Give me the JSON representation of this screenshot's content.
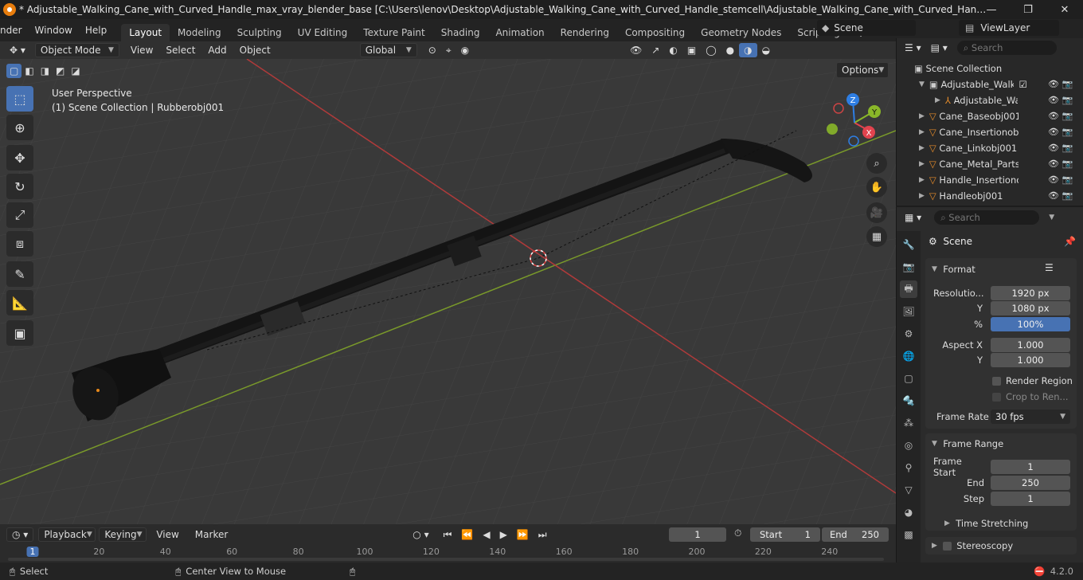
{
  "window": {
    "title": "* Adjustable_Walking_Cane_with_Curved_Handle_max_vray_blender_base [C:\\Users\\lenov\\Desktop\\Adjustable_Walking_Cane_with_Curved_Handle_stemcell\\Adjustable_Walking_Cane_with_Curved_Handle_max_vray_blender_...",
    "min": "—",
    "max": "❐",
    "close": "✕"
  },
  "menu": [
    "nder",
    "Window",
    "Help"
  ],
  "workspaces": [
    "Layout",
    "Modeling",
    "Sculpting",
    "UV Editing",
    "Texture Paint",
    "Shading",
    "Animation",
    "Rendering",
    "Compositing",
    "Geometry Nodes",
    "Scripting"
  ],
  "scene": {
    "scene_label": "Scene",
    "viewlayer_label": "ViewLayer"
  },
  "viewport_header": {
    "mode": "Object Mode",
    "menus": [
      "View",
      "Select",
      "Add",
      "Object"
    ],
    "transform": "Global",
    "options": "Options"
  },
  "viewport": {
    "perspective": "User Perspective",
    "collection_info": "(1) Scene Collection | Rubberobj001",
    "gizmo": {
      "x": "X",
      "y": "Y",
      "z": "Z"
    }
  },
  "outliner": {
    "search_placeholder": "Search",
    "root": "Scene Collection",
    "items": [
      "Adjustable_Walking",
      "Adjustable_Wa",
      "Cane_Baseobj001",
      "Cane_Insertionobj",
      "Cane_Linkobj001",
      "Cane_Metal_Partso",
      "Handle_Insertionol",
      "Handleobj001"
    ]
  },
  "properties": {
    "search_placeholder": "Search",
    "context": "Scene",
    "format": {
      "title": "Format",
      "res_x_label": "Resolutio...",
      "res_x": "1920 px",
      "res_y_label": "Y",
      "res_y": "1080 px",
      "pct_label": "%",
      "pct": "100%",
      "aspect_x_label": "Aspect X",
      "aspect_x": "1.000",
      "aspect_y_label": "Y",
      "aspect_y": "1.000",
      "render_region": "Render Region",
      "crop": "Crop to Ren...",
      "frame_rate_label": "Frame Rate",
      "frame_rate": "30 fps"
    },
    "frame_range": {
      "title": "Frame Range",
      "start_label": "Frame Start",
      "start": "1",
      "end_label": "End",
      "end": "250",
      "step_label": "Step",
      "step": "1"
    },
    "time_stretching": "Time Stretching",
    "stereoscopy": "Stereoscopy"
  },
  "timeline": {
    "menus": [
      "Playback",
      "Keying",
      "View",
      "Marker"
    ],
    "current_frame": "1",
    "start_label": "Start",
    "start": "1",
    "end_label": "End",
    "end": "250",
    "ticks": [
      "1",
      "20",
      "40",
      "60",
      "80",
      "100",
      "120",
      "140",
      "160",
      "180",
      "200",
      "220",
      "240"
    ]
  },
  "status": {
    "select": "Select",
    "center": "Center View to Mouse",
    "version": "4.2.0"
  },
  "colors": {
    "accent": "#4772b3",
    "x_axis": "#e2434e",
    "y_axis": "#8ab729",
    "z_axis": "#2e7ee3"
  }
}
